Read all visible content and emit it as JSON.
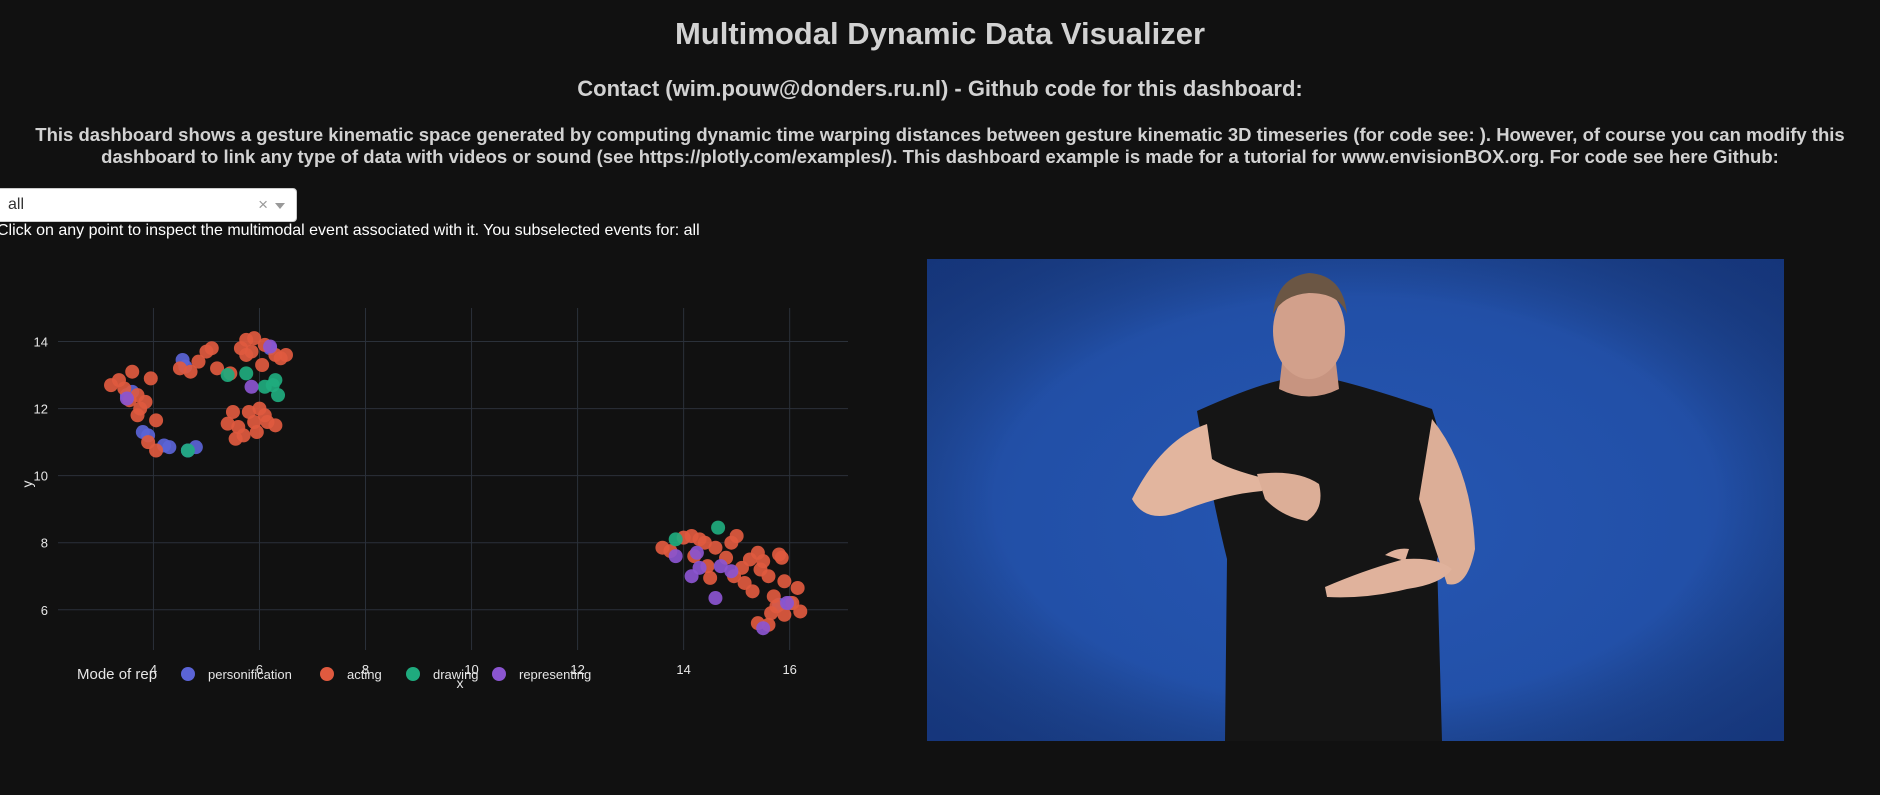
{
  "header": {
    "title": "Multimodal Dynamic Data Visualizer",
    "subtitle": "Contact (wim.pouw@donders.ru.nl) - Github code for this dashboard:",
    "description": "This dashboard shows a gesture kinematic space generated by computing dynamic time warping distances between gesture kinematic 3D timeseries (for code see: ). However, of course you can modify this dashboard to link any type of data with videos or sound (see https://plotly.com/examples/). This dashboard example is made for a tutorial for www.envisionBOX.org. For code see here Github:"
  },
  "dropdown": {
    "selected": "all",
    "clear_glyph": "×"
  },
  "instruction": "Click on any point to inspect the multimodal event associated with it. You subselected events for: all",
  "video": {
    "icon": "video-frame-person-gesturing"
  },
  "chart_data": {
    "type": "scatter",
    "xlabel": "x",
    "ylabel": "y",
    "xlim": [
      2.2,
      17.1
    ],
    "ylim": [
      4.8,
      15.0
    ],
    "xticks": [
      4,
      6,
      8,
      10,
      12,
      14,
      16
    ],
    "yticks": [
      6,
      8,
      10,
      12,
      14
    ],
    "grid": true,
    "legend": {
      "title": "Mode of rep",
      "placement": "bottom"
    },
    "series": [
      {
        "name": "personification",
        "color": "#5b64d6",
        "points": [
          [
            4.55,
            13.45
          ],
          [
            4.6,
            13.25
          ],
          [
            3.5,
            12.4
          ],
          [
            3.6,
            12.5
          ],
          [
            3.8,
            11.3
          ],
          [
            3.9,
            11.2
          ],
          [
            4.2,
            10.9
          ],
          [
            4.3,
            10.85
          ],
          [
            4.8,
            10.85
          ],
          [
            4.65,
            10.75
          ],
          [
            15.8,
            6.15
          ],
          [
            16.0,
            6.2
          ],
          [
            6.2,
            13.8
          ]
        ]
      },
      {
        "name": "acting",
        "color": "#e05a3f",
        "points": [
          [
            3.2,
            12.7
          ],
          [
            3.35,
            12.85
          ],
          [
            3.45,
            12.6
          ],
          [
            3.55,
            12.25
          ],
          [
            3.7,
            12.4
          ],
          [
            3.75,
            12.0
          ],
          [
            3.85,
            12.2
          ],
          [
            3.6,
            13.1
          ],
          [
            3.95,
            12.9
          ],
          [
            3.7,
            11.8
          ],
          [
            4.05,
            11.65
          ],
          [
            3.9,
            11.0
          ],
          [
            4.05,
            10.75
          ],
          [
            4.5,
            13.2
          ],
          [
            4.7,
            13.1
          ],
          [
            4.85,
            13.4
          ],
          [
            5.0,
            13.7
          ],
          [
            5.1,
            13.8
          ],
          [
            5.2,
            13.2
          ],
          [
            5.45,
            13.05
          ],
          [
            5.65,
            13.8
          ],
          [
            5.75,
            14.05
          ],
          [
            5.9,
            14.1
          ],
          [
            6.05,
            13.3
          ],
          [
            6.1,
            13.9
          ],
          [
            6.3,
            13.6
          ],
          [
            6.4,
            13.5
          ],
          [
            6.5,
            13.6
          ],
          [
            5.4,
            11.55
          ],
          [
            5.5,
            11.9
          ],
          [
            5.6,
            11.45
          ],
          [
            5.55,
            11.1
          ],
          [
            5.7,
            11.2
          ],
          [
            5.8,
            11.9
          ],
          [
            5.9,
            11.6
          ],
          [
            5.95,
            11.3
          ],
          [
            6.0,
            12.0
          ],
          [
            6.1,
            11.8
          ],
          [
            6.15,
            11.6
          ],
          [
            6.3,
            11.5
          ],
          [
            5.75,
            13.6
          ],
          [
            5.85,
            13.7
          ],
          [
            13.6,
            7.85
          ],
          [
            13.75,
            7.75
          ],
          [
            14.0,
            8.15
          ],
          [
            14.15,
            8.2
          ],
          [
            14.3,
            8.1
          ],
          [
            14.4,
            8.0
          ],
          [
            14.2,
            7.6
          ],
          [
            14.45,
            7.3
          ],
          [
            14.5,
            6.95
          ],
          [
            14.6,
            7.85
          ],
          [
            14.8,
            7.55
          ],
          [
            14.9,
            8.0
          ],
          [
            15.0,
            8.2
          ],
          [
            14.95,
            7.0
          ],
          [
            15.1,
            7.25
          ],
          [
            15.15,
            6.8
          ],
          [
            15.25,
            7.5
          ],
          [
            15.3,
            6.55
          ],
          [
            15.4,
            7.7
          ],
          [
            15.45,
            7.2
          ],
          [
            15.5,
            7.45
          ],
          [
            15.6,
            7.0
          ],
          [
            15.65,
            5.9
          ],
          [
            15.7,
            6.4
          ],
          [
            15.75,
            6.1
          ],
          [
            15.8,
            7.65
          ],
          [
            15.85,
            7.55
          ],
          [
            15.9,
            6.85
          ],
          [
            15.9,
            5.85
          ],
          [
            15.4,
            5.6
          ],
          [
            15.6,
            5.55
          ],
          [
            16.05,
            6.2
          ],
          [
            16.15,
            6.65
          ],
          [
            16.2,
            5.95
          ]
        ]
      },
      {
        "name": "drawing",
        "color": "#1fab7e",
        "points": [
          [
            5.4,
            13.0
          ],
          [
            5.75,
            13.05
          ],
          [
            6.1,
            12.65
          ],
          [
            6.25,
            12.7
          ],
          [
            6.3,
            12.85
          ],
          [
            6.35,
            12.4
          ],
          [
            4.65,
            10.75
          ],
          [
            13.85,
            8.1
          ],
          [
            14.65,
            8.45
          ]
        ]
      },
      {
        "name": "representing",
        "color": "#8b55d0",
        "points": [
          [
            3.5,
            12.3
          ],
          [
            6.2,
            13.85
          ],
          [
            5.85,
            12.65
          ],
          [
            13.85,
            7.6
          ],
          [
            14.15,
            7.0
          ],
          [
            14.25,
            7.7
          ],
          [
            14.3,
            7.25
          ],
          [
            14.6,
            6.35
          ],
          [
            14.7,
            7.3
          ],
          [
            14.9,
            7.15
          ],
          [
            15.5,
            5.45
          ],
          [
            15.95,
            6.2
          ]
        ]
      }
    ]
  }
}
